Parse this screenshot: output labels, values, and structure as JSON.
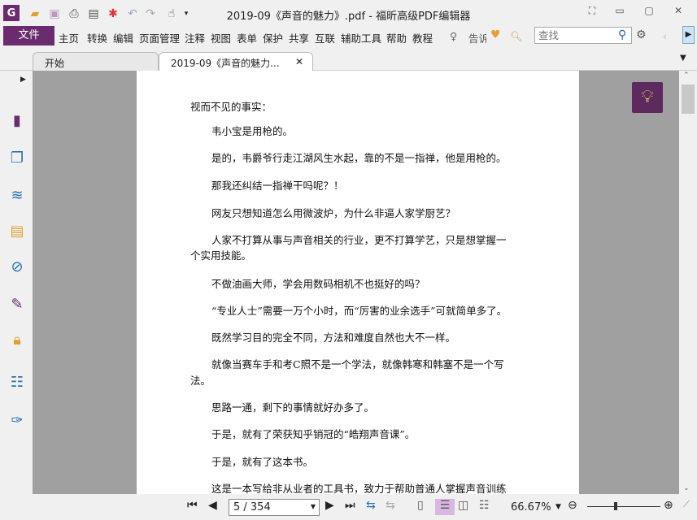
{
  "window": {
    "title": "2019-09《声音的魅力》.pdf - 福昕高级PDF编辑器"
  },
  "menu": {
    "file": "文件",
    "items": [
      "主页",
      "转换",
      "编辑",
      "页面管理",
      "注释",
      "视图",
      "表单",
      "保护",
      "共享",
      "互联",
      "辅助工具",
      "帮助",
      "教程"
    ],
    "tell": "告诉",
    "search_placeholder": "查找"
  },
  "tabs": [
    {
      "label": "开始"
    },
    {
      "label": "2019-09《声音的魅力..."
    }
  ],
  "document": {
    "lines": [
      "视而不见的事实：",
      "韦小宝是用枪的。",
      "是的，韦爵爷行走江湖风生水起，靠的不是一指禅，他是用枪的。",
      "那我还纠结一指禅干吗呢？！",
      "网友只想知道怎么用微波炉，为什么非逼人家学厨艺？",
      "人家不打算从事与声音相关的行业，更不打算学艺，只是想掌握一",
      "个实用技能。",
      "不做油画大师，学会用数码相机不也挺好的吗？",
      "“专业人士”需要一万个小时，而“厉害的业余选手”可就简单多了。",
      "既然学习目的完全不同，方法和难度自然也大不一样。",
      "就像当赛车手和考C照不是一个学法，就像韩寒和韩塞不是一个写",
      "法。",
      "思路一通，剩下的事情就好办多了。",
      "于是，就有了荣获知乎销冠的“皓翔声音课”。",
      "于是，就有了这本书。",
      "这是一本写给非从业者的工具书，致力于帮助普通人掌握声音训练"
    ]
  },
  "status": {
    "page": "5 / 354",
    "zoom": "66.67%",
    "zoom_fraction": 0.6667
  },
  "colors": {
    "accent": "#6a2c6f"
  }
}
